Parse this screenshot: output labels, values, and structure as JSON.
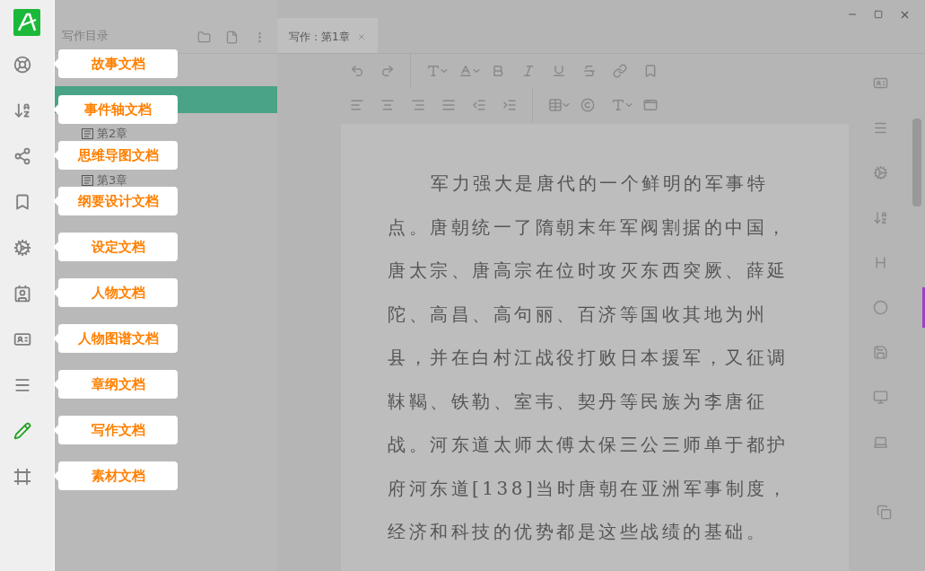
{
  "rail": [
    {
      "tip": "故事文档",
      "selected": false
    },
    {
      "tip": "事件轴文档",
      "selected": false
    },
    {
      "tip": "思维导图文档",
      "selected": false
    },
    {
      "tip": "纲要设计文档",
      "selected": false
    },
    {
      "tip": "设定文档",
      "selected": false
    },
    {
      "tip": "人物文档",
      "selected": false
    },
    {
      "tip": "人物图谱文档",
      "selected": false
    },
    {
      "tip": "章纲文档",
      "selected": false
    },
    {
      "tip": "写作文档",
      "selected": true
    },
    {
      "tip": "素材文档",
      "selected": false
    }
  ],
  "panel": {
    "title": "写作目录",
    "items": [
      {
        "selected": true
      },
      {
        "label": "第2章",
        "selected": false
      },
      {
        "label": "第3章",
        "selected": false
      }
    ]
  },
  "tabs": [
    {
      "label": "写作：第1章",
      "selected": true
    }
  ],
  "document": {
    "text": "军力强大是唐代的一个鲜明的军事特点。唐朝统一了隋朝末年军阀割据的中国，唐太宗、唐高宗在位时攻灭东西突厥、薛延陀、高昌、高句丽、百济等国收其地为州县，并在白村江战役打败日本援军，又征调靺鞨、铁勒、室韦、契丹等民族为李唐征战。河东道太师太傅太保三公三师单于都护府河东道[138]当时唐朝在亚洲军事制度，经济和科技的优势都是这些战绩的基础。"
  }
}
